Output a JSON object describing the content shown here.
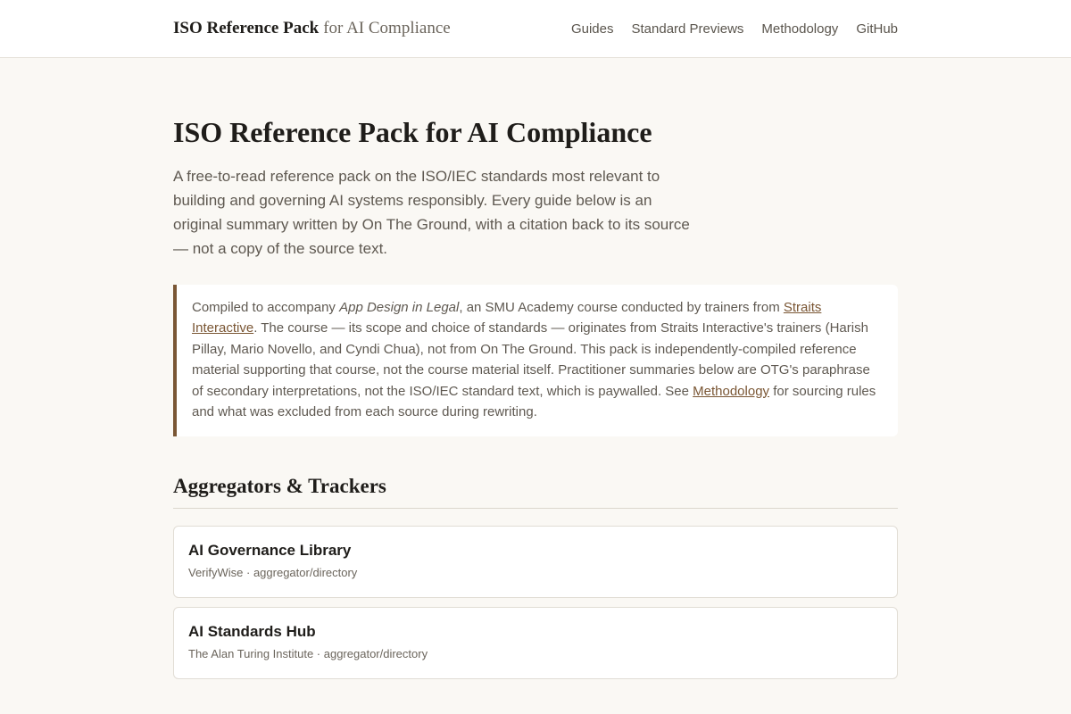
{
  "header": {
    "brand_strong": "ISO Reference Pack",
    "brand_light": "for AI Compliance",
    "nav": [
      {
        "label": "Guides"
      },
      {
        "label": "Standard Previews"
      },
      {
        "label": "Methodology"
      },
      {
        "label": "GitHub"
      }
    ]
  },
  "hero": {
    "title": "ISO Reference Pack for AI Compliance",
    "lede": "A free-to-read reference pack on the ISO/IEC standards most relevant to building and governing AI systems responsibly. Every guide below is an original summary written by On The Ground, with a citation back to its source — not a copy of the source text."
  },
  "callout": {
    "part1": "Compiled to accompany ",
    "course_name": "App Design in Legal",
    "part2": ", an SMU Academy course conducted by trainers from ",
    "link1": "Straits Interactive",
    "part3": ". The course — its scope and choice of standards — originates from Straits Interactive's trainers (Harish Pillay, Mario Novello, and Cyndi Chua), not from On The Ground. This pack is independently-compiled reference material supporting that course, not the course material itself. Practitioner summaries below are OTG's paraphrase of secondary interpretations, not the ISO/IEC standard text, which is paywalled. See ",
    "link2": "Methodology",
    "part4": " for sourcing rules and what was excluded from each source during rewriting."
  },
  "section": {
    "title": "Aggregators & Trackers",
    "cards": [
      {
        "title": "AI Governance Library",
        "meta": "VerifyWise · aggregator/directory"
      },
      {
        "title": "AI Standards Hub",
        "meta": "The Alan Turing Institute · aggregator/directory"
      }
    ]
  },
  "colors": {
    "accent": "#7a5634",
    "background": "#faf8f4",
    "text": "#1f1d1a",
    "muted": "#5f5951"
  }
}
